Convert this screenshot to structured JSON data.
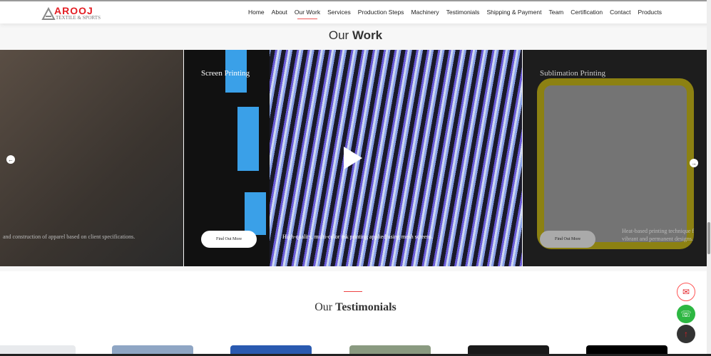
{
  "nav": {
    "logo_brand": "AROOJ",
    "logo_sub": "TEXTILE & SPORTS",
    "items": [
      "Home",
      "About",
      "Our Work",
      "Services",
      "Production Steps",
      "Machinery",
      "Testimonials",
      "Shipping & Payment",
      "Team",
      "Certification",
      "Contact",
      "Products"
    ],
    "active": "Our Work"
  },
  "work": {
    "title_light": "Our",
    "title_bold": "Work",
    "slides": [
      {
        "title": "",
        "text": "and construction of apparel based on client specifications."
      },
      {
        "title": "Screen Printing",
        "text": "High-quality, multi-color ink printing applied using mesh screens.",
        "button": "Find Out More"
      },
      {
        "title": "Sublimation Printing",
        "text": "Heat-based printing technique f",
        "text2": "vibrant and permanent designs.",
        "button": "Find Out More"
      }
    ]
  },
  "testimonials": {
    "title_light": "Our",
    "title_bold": "Testimonials"
  },
  "colors": {
    "accent": "#e31e24",
    "whatsapp": "#2db742"
  }
}
